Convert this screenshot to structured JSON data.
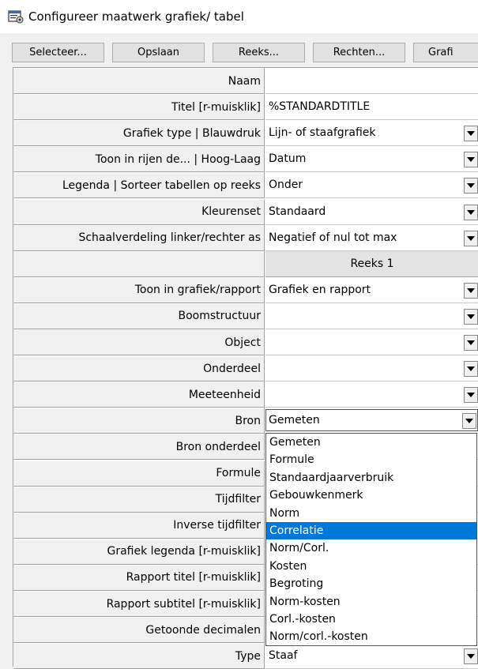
{
  "window": {
    "title": "Configureer maatwerk grafiek/ tabel"
  },
  "toolbar": {
    "buttons": [
      "Selecteer...",
      "Opslaan",
      "Reeks...",
      "Rechten...",
      "Grafi"
    ]
  },
  "rows": [
    {
      "label": "Naam",
      "value": "",
      "dropdown": false
    },
    {
      "label": "Titel [r-muisklik]",
      "value": "%STANDARDTITLE",
      "dropdown": false
    },
    {
      "label": "Grafiek type | Blauwdruk",
      "value": "Lijn- of staafgrafiek",
      "dropdown": true
    },
    {
      "label": "Toon in rijen de... | Hoog-Laag",
      "value": "Datum",
      "dropdown": true
    },
    {
      "label": "Legenda | Sorteer tabellen op reeks",
      "value": "Onder",
      "dropdown": true
    },
    {
      "label": "Kleurenset",
      "value": "Standaard",
      "dropdown": true
    },
    {
      "label": "Schaalverdeling linker/rechter as",
      "value": "Negatief of nul tot max",
      "dropdown": true
    },
    {
      "label": "",
      "value": "Reeks 1",
      "section": true
    },
    {
      "label": "Toon in grafiek/rapport",
      "value": "Grafiek en rapport",
      "dropdown": true
    },
    {
      "label": "Boomstructuur",
      "value": "",
      "dropdown": true
    },
    {
      "label": "Object",
      "value": "",
      "dropdown": true
    },
    {
      "label": "Onderdeel",
      "value": "",
      "dropdown": true
    },
    {
      "label": "Meeteenheid",
      "value": "",
      "dropdown": true
    },
    {
      "label": "Bron",
      "value": "Gemeten",
      "dropdown": true,
      "active": true
    },
    {
      "label": "Bron onderdeel",
      "value": ""
    },
    {
      "label": "Formule",
      "value": ""
    },
    {
      "label": "Tijdfilter",
      "value": ""
    },
    {
      "label": "Inverse tijdfilter",
      "value": ""
    },
    {
      "label": "Grafiek legenda [r-muisklik]",
      "value": ""
    },
    {
      "label": "Rapport titel [r-muisklik]",
      "value": ""
    },
    {
      "label": "Rapport subtitel [r-muisklik]",
      "value": ""
    },
    {
      "label": "Getoonde decimalen",
      "value": ""
    },
    {
      "label": "Type",
      "value": "Staaf",
      "dropdown": true
    }
  ],
  "bron_dropdown": {
    "selected_index": 5,
    "options": [
      "Gemeten",
      "Formule",
      "Standaardjaarverbruik",
      "Gebouwkenmerk",
      "Norm",
      "Correlatie",
      "Norm/Corl.",
      "Kosten",
      "Begroting",
      "Norm-kosten",
      "Corl.-kosten",
      "Norm/corl.-kosten"
    ]
  },
  "icons": {
    "app": "settings-window-icon",
    "dropdown": "chevron-down-icon"
  },
  "colors": {
    "selection": "#0078d7",
    "section_bg": "#e3e3e3"
  }
}
